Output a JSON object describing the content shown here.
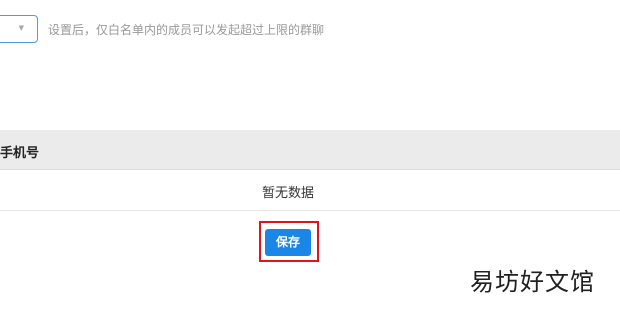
{
  "group_limit": {
    "select_value": "",
    "dropdown_icon": "chevron-down-icon",
    "hint": "设置后，仅白名单内的成员可以发起超过上限的群聊"
  },
  "members_table": {
    "columns": [
      "手机号"
    ],
    "empty_text": "暂无数据"
  },
  "actions": {
    "save_label": "保存",
    "highlight_color": "#e0141c",
    "button_color": "#1a86e8"
  },
  "watermark": "易坊好文馆"
}
